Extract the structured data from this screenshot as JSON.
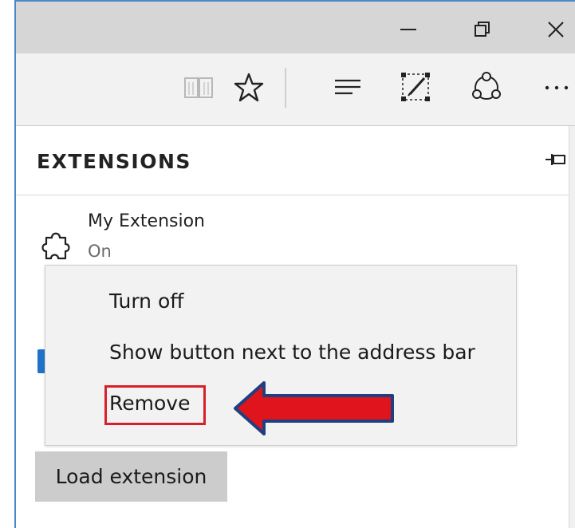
{
  "titlebar": {
    "minimize_icon": "minimize-icon",
    "restore_icon": "restore-icon",
    "close_icon": "close-icon"
  },
  "toolbar": {
    "icons": [
      "reading-view-icon",
      "favorite-star-icon",
      "hub-icon",
      "web-note-icon",
      "share-icon",
      "more-icon"
    ]
  },
  "pane": {
    "title": "EXTENSIONS",
    "pin_icon": "pin-icon"
  },
  "extension": {
    "name": "My Extension",
    "status": "On",
    "icon": "puzzle-icon"
  },
  "context_menu": {
    "items": [
      "Turn off",
      "Show button next to the address bar",
      "Remove"
    ],
    "highlight_color": "#d9202a",
    "arrow_color": "#e0141c"
  },
  "load_button": {
    "label": "Load extension"
  }
}
